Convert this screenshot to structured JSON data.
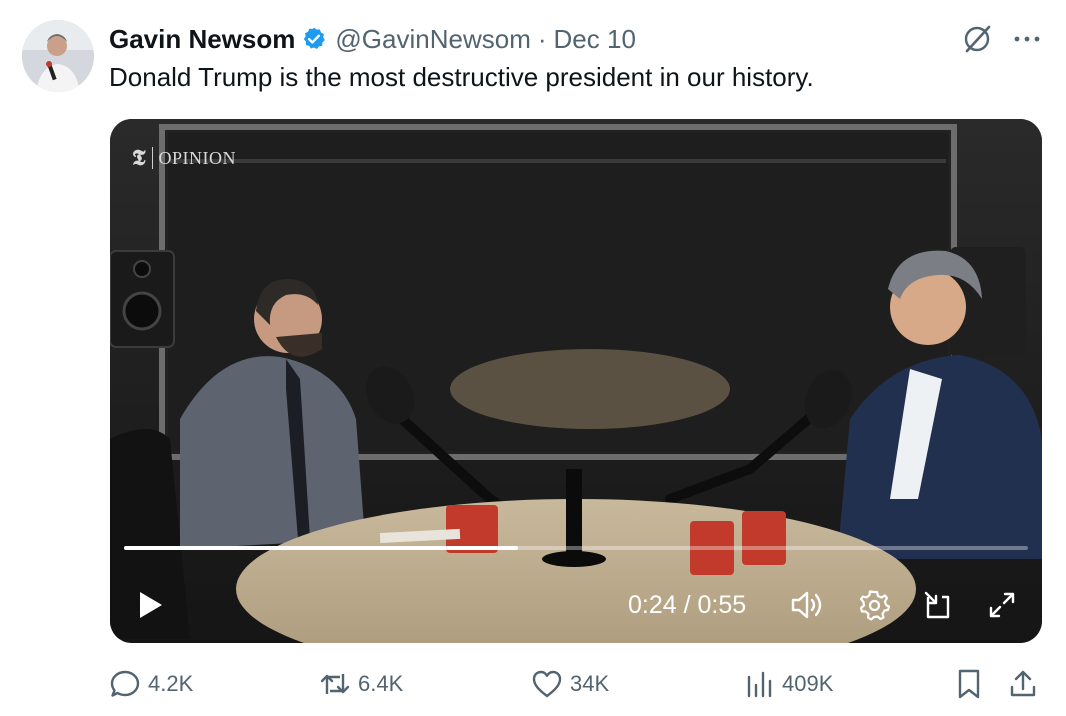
{
  "post": {
    "author_name": "Gavin Newsom",
    "handle": "@GavinNewsom",
    "separator": "·",
    "date": "Dec 10",
    "text": "Donald Trump is the most destructive president in our history.",
    "verified_color": "#1d9bf0"
  },
  "video": {
    "brand_logo": "𝕿",
    "brand_label": "OPINION",
    "current_time": "0:24",
    "time_separator": " / ",
    "duration": "0:55",
    "progress_fraction": 0.436
  },
  "icons": {
    "grok": "grok-icon",
    "more": "more-icon",
    "play": "play-icon",
    "volume": "volume-icon",
    "settings": "gear-icon",
    "dock": "dock-icon",
    "fullscreen": "fullscreen-icon",
    "reply": "reply-icon",
    "repost": "repost-icon",
    "like": "heart-icon",
    "views": "views-icon",
    "bookmark": "bookmark-icon",
    "share": "share-icon"
  },
  "stats": {
    "replies": "4.2K",
    "reposts": "6.4K",
    "likes": "34K",
    "views": "409K"
  },
  "colors": {
    "text_primary": "#0f1419",
    "text_secondary": "#536471",
    "accent": "#1d9bf0"
  }
}
